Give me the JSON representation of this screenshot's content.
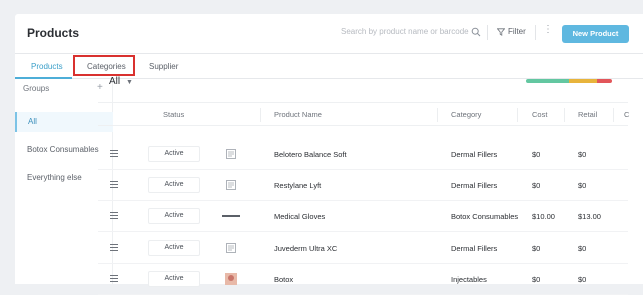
{
  "header": {
    "title": "Products",
    "search_placeholder": "Search by product name or barcode",
    "filter_label": "Filter",
    "new_button": "New Product"
  },
  "tabs": [
    {
      "label": "Products",
      "active": true
    },
    {
      "label": "Categories",
      "active": false,
      "highlighted": true
    },
    {
      "label": "Supplier",
      "active": false
    }
  ],
  "sidebar": {
    "groups_label": "Groups",
    "add_symbol": "+",
    "items": [
      {
        "label": "All",
        "selected": true
      },
      {
        "label": "Botox Consumables",
        "selected": false
      },
      {
        "label": "Everything else",
        "selected": false
      }
    ]
  },
  "toolbar": {
    "selected_group": "All"
  },
  "stock_bar": {
    "colors": [
      "#63c7a1",
      "#e8b43c",
      "#e2565a"
    ],
    "fractions": [
      0.5,
      0.32,
      0.18
    ]
  },
  "table": {
    "columns": [
      "Status",
      "Product Name",
      "Category",
      "Cost",
      "Retail",
      "C"
    ],
    "rows": [
      {
        "status": "Active",
        "thumb": "barcode-icon",
        "name": "Belotero Balance Soft",
        "category": "Dermal Fillers",
        "cost": "$0",
        "retail": "$0"
      },
      {
        "status": "Active",
        "thumb": "barcode-icon",
        "name": "Restylane Lyft",
        "category": "Dermal Fillers",
        "cost": "$0",
        "retail": "$0"
      },
      {
        "status": "Active",
        "thumb": "gloves-image",
        "name": "Medical Gloves",
        "category": "Botox Consumables",
        "cost": "$10.00",
        "retail": "$13.00"
      },
      {
        "status": "Active",
        "thumb": "barcode-icon",
        "name": "Juvederm Ultra XC",
        "category": "Dermal Fillers",
        "cost": "$0",
        "retail": "$0"
      },
      {
        "status": "Active",
        "thumb": "botox-image",
        "name": "Botox",
        "category": "Injectables",
        "cost": "$0",
        "retail": "$0"
      }
    ]
  }
}
